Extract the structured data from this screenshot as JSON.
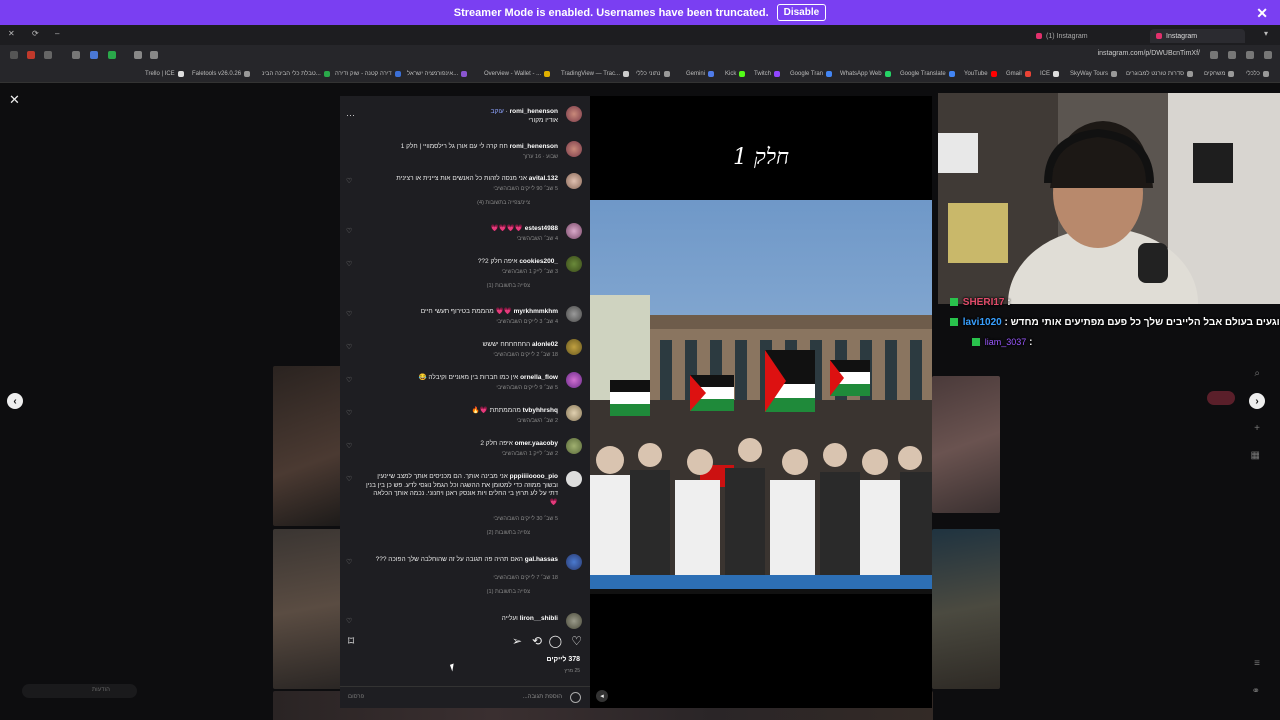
{
  "banner": {
    "text": "Streamer Mode is enabled. Usernames have been truncated.",
    "button": "Disable"
  },
  "browser": {
    "tabs": [
      {
        "label": "(1) Instagram"
      },
      {
        "label": "Instagram"
      }
    ],
    "url": "instagram.com/p/DWUBcnTimXf/",
    "bookmarks": [
      "Trello | ICE",
      "Faletools v26.0.26",
      "טבלת כלי הבינה הבינ...",
      "דירה קטנה - שוק ודירה",
      "אינפורמציה ישראל...",
      "Overview - Wallet - ...",
      "TradingView — Trac...",
      "נתוני כללי",
      "Gemini",
      "Kick",
      "Twitch",
      "Google Tran",
      "WhatsApp Web",
      "Google Translate",
      "YouTube",
      "Gmail",
      "ICE",
      "SkyWay Tours",
      "סדרות טורנט למבוגרים",
      "משחקים",
      "כלכלי"
    ]
  },
  "post": {
    "caption_user": "romi_henenson",
    "caption_follow": "עוקב",
    "caption_sub": "אודיו מקורי",
    "caption_text": "חח קרה לי עם אורן גל רילסמוויי | חלק 1",
    "caption_time": "שבוע · 16 ערוך",
    "likes": "378 לייקים",
    "date": "25 מרץ",
    "add_comment_placeholder": "הוספת תגובה...",
    "post_button": "פרסום",
    "video_title": "חלק 1"
  },
  "comments": [
    {
      "user": "avital.132",
      "text": "אני מנסה לזהות כל האנשים אות ציינית או רצינית",
      "meta": "5 שב׳  90 לייקים  השב/השיבי",
      "replies": "ציינ/צפייה בתשובות (4)"
    },
    {
      "user": "estest4988",
      "text": "💗💗💗💗",
      "meta": "4 שב׳  השב/השיבי",
      "replies": ""
    },
    {
      "user": "_cookies200",
      "text": "איפה חלק 2??",
      "meta": "3 שב׳  לייק 1  השב/השיבי",
      "replies": "צפייה בתשובות (1)"
    },
    {
      "user": "myrkhmmkhm",
      "text": "💗💗 מהממת בטירוף תעשי חיים",
      "meta": "4 שב׳  3 לייקים  השב/השיבי",
      "replies": ""
    },
    {
      "user": "alonle02",
      "text": "החחחחחח יששש",
      "meta": "18 שב׳  2 לייקים  השב/השיבי",
      "replies": ""
    },
    {
      "user": "ornella_flow",
      "text": "אין כמו חברות בין מאוניים וקיבלה 😂",
      "meta": "5 שב׳  9 לייקים  השב/השיבי",
      "replies": ""
    },
    {
      "user": "tvbyhhrshq",
      "text": "מהממתתת 💗🔥",
      "meta": "2 שב׳  השב/השיבי",
      "replies": ""
    },
    {
      "user": "omer.yaacoby",
      "text": "איפה חלק 2",
      "meta": "2 שב׳  לייק 1  השב/השיבי",
      "replies": ""
    },
    {
      "user": "pppiiiioooo_pio",
      "text": "אני מבינה אותך. הם מכניסים אותך למצב שיינעין ובשוך ממוזה כדי למטומן את ההשגה וכל הגמל נוגסי לדע. פש כן בין בנין דתי על לע תרוץ בי החלים ויות אונסק ראנן ויחנוני. נכמה אותך הכלאה 💗",
      "meta": "5 שב׳  30 לייקים  השב/השיבי",
      "replies": "צפייה בתשובות (2)"
    },
    {
      "user": "gal.hassas",
      "text": "האם תהיה פה תגובה על זה שהוחלבה שלך הפוכה ???",
      "meta": "18 שב׳  7 לייקים  השב/השיבי",
      "replies": "צפייה בתשובות (1)"
    },
    {
      "user": "liron__shibli",
      "text": "ועלייה",
      "meta": "",
      "replies": ""
    }
  ],
  "chat": [
    {
      "user": "SHERI17",
      "text": ""
    },
    {
      "user": "lavi1020",
      "text": "שוגעים בעולם אבל הלייבים שלך כל פעם מפתיעים אותי מחדש"
    },
    {
      "user": "liam_3037",
      "text": ""
    }
  ],
  "left_badge": "הודעות",
  "icons": {
    "close": "close-icon",
    "prev": "chevron-left-icon",
    "next": "chevron-right-icon",
    "save": "bookmark-icon",
    "share": "send-icon",
    "repost": "repost-icon",
    "comment": "comment-icon",
    "like": "heart-icon",
    "emoji": "emoji-icon",
    "mute": "mute-icon"
  }
}
